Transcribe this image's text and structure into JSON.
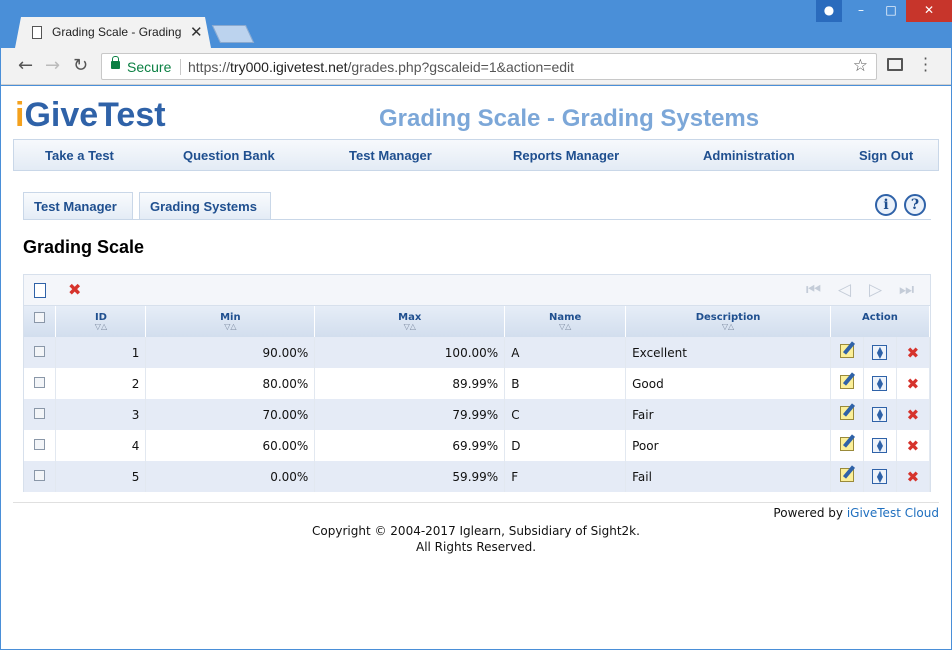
{
  "browser": {
    "tab_title": "Grading Scale - Grading Systems",
    "tab_close": "✕",
    "secure_label": "Secure",
    "url_scheme": "https://",
    "url_host": "try000.igivetest.net",
    "url_path": "/grades.php?gscaleid=1&action=edit"
  },
  "header": {
    "logo_i": "i",
    "logo_rest": "GiveTest",
    "page_title": "Grading Scale - Grading Systems"
  },
  "mainnav": [
    "Take a Test",
    "Question Bank",
    "Test Manager",
    "Reports Manager",
    "Administration",
    "Sign Out"
  ],
  "subtabs": [
    "Test Manager",
    "Grading Systems"
  ],
  "help": {
    "info": "i",
    "question": "?"
  },
  "section_title": "Grading Scale",
  "table": {
    "headers": {
      "id": "ID",
      "min": "Min",
      "max": "Max",
      "name": "Name",
      "description": "Description",
      "action": "Action"
    },
    "rows": [
      {
        "id": "1",
        "min": "90.00%",
        "max": "100.00%",
        "name": "A",
        "description": "Excellent"
      },
      {
        "id": "2",
        "min": "80.00%",
        "max": "89.99%",
        "name": "B",
        "description": "Good"
      },
      {
        "id": "3",
        "min": "70.00%",
        "max": "79.99%",
        "name": "C",
        "description": "Fair"
      },
      {
        "id": "4",
        "min": "60.00%",
        "max": "69.99%",
        "name": "D",
        "description": "Poor"
      },
      {
        "id": "5",
        "min": "0.00%",
        "max": "59.99%",
        "name": "F",
        "description": "Fail"
      }
    ]
  },
  "footer": {
    "powered_by": "Powered by",
    "powered_link": "iGiveTest Cloud",
    "copyright_line1": "Copyright © 2004-2017 Iglearn, Subsidiary of Sight2k.",
    "copyright_line2": "All Rights Reserved."
  },
  "colors": {
    "brand_blue": "#2f62a8",
    "brand_orange": "#f4a11d",
    "title_blue": "#7ca7d8",
    "nav_text": "#1f4f8f",
    "delete_red": "#d6332c"
  }
}
